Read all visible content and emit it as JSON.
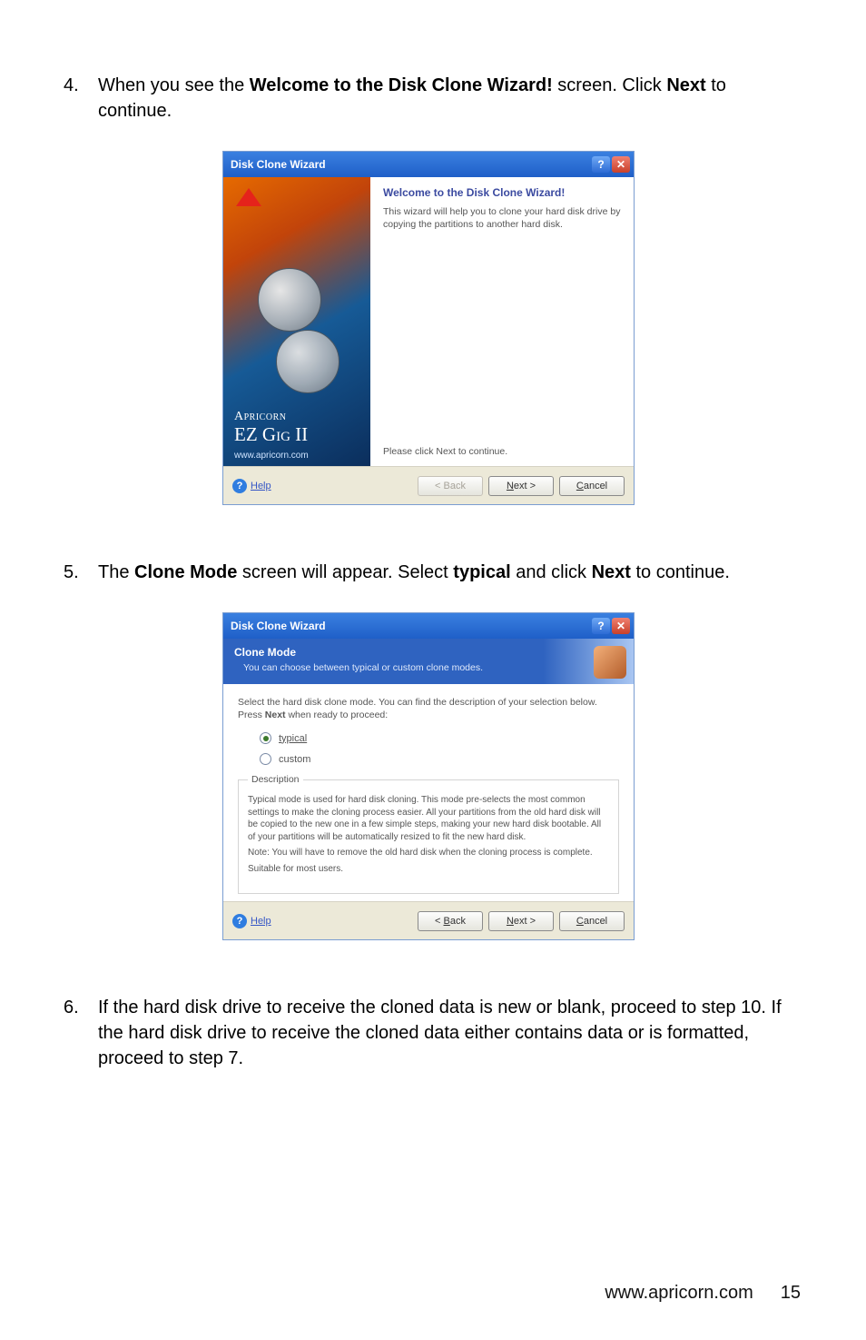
{
  "steps": {
    "s4": {
      "num": "4.",
      "pre": "When you see the ",
      "bold1": "Welcome to the Disk Clone Wizard!",
      "mid": " screen.  Click ",
      "bold2": "Next",
      "post": " to continue."
    },
    "s5": {
      "num": "5.",
      "pre": "The ",
      "bold1": "Clone Mode",
      "mid1": " screen will appear.  Select ",
      "bold2": "typical",
      "mid2": " and click ",
      "bold3": "Next",
      "post": " to continue."
    },
    "s6": {
      "num": "6.",
      "text": "If the hard disk drive to receive the cloned data is new or blank, proceed to step 10.  If the hard disk drive to receive the cloned data either contains data or is formatted, proceed to step 7."
    }
  },
  "wiz1": {
    "title": "Disk Clone Wizard",
    "help_glyph": "?",
    "close_glyph": "✕",
    "sidebar": {
      "brand_l1": "Apricorn",
      "brand_l2": "EZ Gig II",
      "url": "www.apricorn.com"
    },
    "heading": "Welcome to the Disk Clone Wizard!",
    "intro": "This wizard will help you to clone your hard disk drive by copying the partitions to another hard disk.",
    "please": "Please click Next to continue.",
    "buttons": {
      "help": "Help",
      "back": "< Back",
      "next": "Next >",
      "cancel": "Cancel"
    }
  },
  "wiz2": {
    "title": "Disk Clone Wizard",
    "help_glyph": "?",
    "close_glyph": "✕",
    "header_title": "Clone Mode",
    "header_sub": "You can choose between typical or custom clone modes.",
    "lead_pre": "Select the hard disk clone mode. You can find the description of your selection below. Press ",
    "lead_bold": "Next",
    "lead_post": " when ready to proceed:",
    "opt_typical": "typical",
    "opt_custom": "custom",
    "desc_legend": "Description",
    "desc_p1": "Typical mode is used for hard disk cloning. This mode pre-selects the most common settings to make the cloning process easier. All your partitions from the old hard disk will be copied to the new one in a few simple steps, making your new hard disk bootable. All of your partitions will be automatically resized to fit the new hard disk.",
    "desc_p2": "Note: You will have to remove the old hard disk when the cloning process is complete.",
    "desc_p3": "Suitable for most users.",
    "buttons": {
      "help": "Help",
      "back": "< Back",
      "next": "Next >",
      "cancel": "Cancel"
    }
  },
  "footer": {
    "url": "www.apricorn.com",
    "page": "15"
  }
}
